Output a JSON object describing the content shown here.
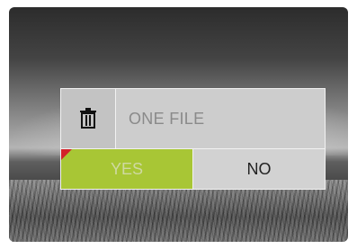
{
  "dialog": {
    "icon": "trash-can-icon",
    "message": "ONE FILE",
    "yes_label": "YES",
    "no_label": "NO",
    "selected": "YES"
  },
  "colors": {
    "accent_selected": "#a8c635",
    "selection_marker": "#d2222a"
  }
}
